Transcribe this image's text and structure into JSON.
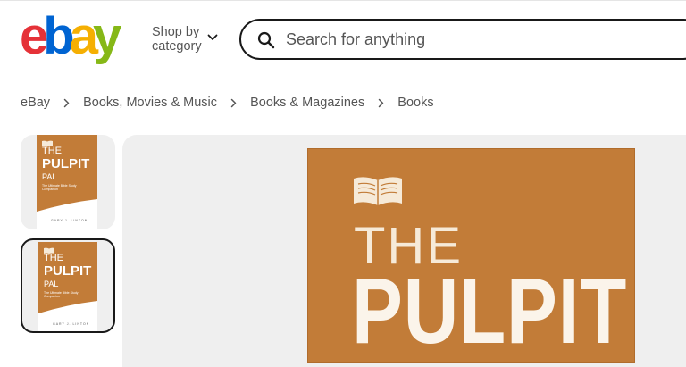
{
  "header": {
    "logo_letters": [
      {
        "char": "e",
        "color": "#e53238"
      },
      {
        "char": "b",
        "color": "#0064d2"
      },
      {
        "char": "a",
        "color": "#f5af02"
      },
      {
        "char": "y",
        "color": "#86b817"
      }
    ],
    "shop_by_line1": "Shop by",
    "shop_by_line2": "category",
    "search_placeholder": "Search for anything"
  },
  "breadcrumb": [
    "eBay",
    "Books, Movies & Music",
    "Books & Magazines",
    "Books"
  ],
  "book": {
    "title_top": "THE",
    "title_main": "PULPIT",
    "title_sub": "PAL",
    "thumb_subtitle": "The Ultimate Bible Study Companion",
    "author": "GARY J. LINTON",
    "cover_color": "#c27c38"
  }
}
